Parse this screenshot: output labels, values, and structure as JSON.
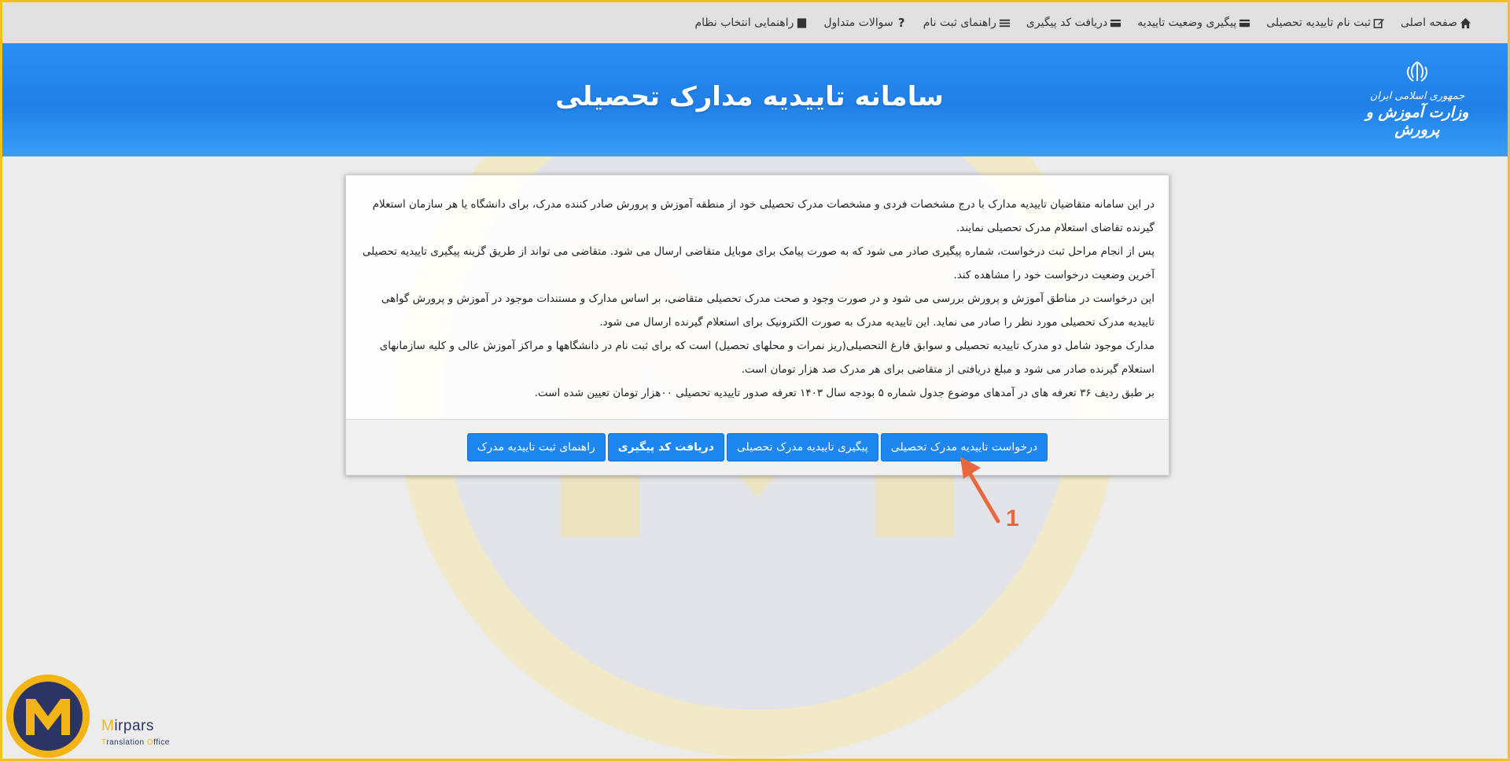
{
  "nav": {
    "items": [
      {
        "label": "صفحه اصلی",
        "icon": "home-icon"
      },
      {
        "label": "ثبت نام تاییدیه تحصیلی",
        "icon": "edit-icon"
      },
      {
        "label": "پیگیری وضعیت تاییدیه",
        "icon": "card-icon"
      },
      {
        "label": "دریافت کد پیگیری",
        "icon": "card-icon"
      },
      {
        "label": "راهنمای ثبت نام",
        "icon": "list-icon"
      },
      {
        "label": "سوالات متداول",
        "icon": "question-icon"
      },
      {
        "label": "راهنمایی انتخاب نظام",
        "icon": "book-icon"
      }
    ]
  },
  "header": {
    "title": "سامانه تاییدیه مدارک تحصیلی",
    "emblem_line1": "جمهوری اسلامی ایران",
    "emblem_line2": "وزارت آموزش و پرورش"
  },
  "content": {
    "paragraphs": [
      "در این سامانه متقاضیان تاییدیه مدارک با درج مشخصات فردی و مشخصات مدرک تحصیلی خود از منطقه آموزش و پرورش صادر کننده مدرک، برای دانشگاه یا هر سازمان استعلام گیرنده تقاضای استعلام مدرک تحصیلی نمایند.",
      "پس از انجام مراحل ثبت درخواست، شماره پیگیری صادر می شود که به صورت پیامک برای موبایل متقاضی ارسال می شود. متقاضی می تواند از طریق گزینه پیگیری تاییدیه تحصیلی آخرین وضعیت درخواست خود را مشاهده کند.",
      "این درخواست در مناطق آموزش و پرورش بررسی می شود و در صورت وجود و صحت مدرک تحصیلی متقاضی، بر اساس مدارک و مستندات موجود در آموزش و پرورش گواهی تاییدیه مدرک تحصیلی مورد نظر را صادر می نماید. این تاییدیه مدرک به صورت الکترونیک برای استعلام گیرنده ارسال می شود.",
      "مدارک موجود شامل دو مدرک تاییدیه تحصیلی و سوابق فارغ التحصیلی(ریز نمرات و محلهای تحصیل) است که برای ثبت نام در دانشگاهها و مراکز آموزش عالی و کلیه سازمانهای استعلام گیرنده صادر می شود و مبلغ دریافتی از متقاضی برای هر مدرک صد هزار تومان است.",
      "بر طبق ردیف ۳۶ تعرفه های در آمدهای موضوع جدول شماره ۵ بودجه سال ۱۴۰۳ تعرفه صدور تاییدیه تحصیلی ۰۰هزار تومان تعیین شده است."
    ]
  },
  "buttons": {
    "request": "درخواست تاییدیه مدرک تحصیلی",
    "track": "پیگیری تاییدیه مدرک تحصیلی",
    "get_code": "دریافت کد پیگیری",
    "guide": "راهنمای ثبت تاییدیه مدرک"
  },
  "annotation": {
    "number": "1",
    "color": "#e8673d"
  },
  "brand": {
    "name_first": "M",
    "name_rest": "irpars",
    "sub_t": "T",
    "sub_mid": "ranslation ",
    "sub_o": "O",
    "sub_end": "ffice",
    "colors": {
      "navy": "#2c3465",
      "gold": "#f2b515"
    }
  },
  "colors": {
    "banner": "#1f7fe6",
    "button": "#1d86ef",
    "frame": "#f2c21a"
  }
}
